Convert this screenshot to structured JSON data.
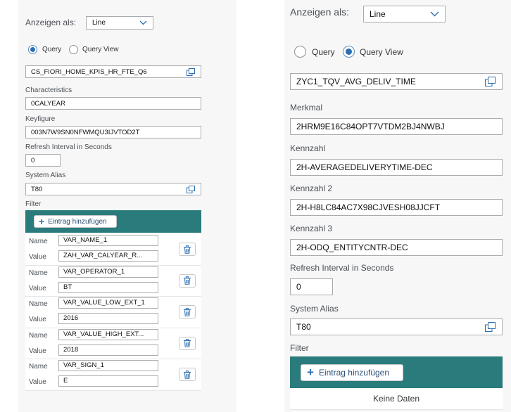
{
  "left": {
    "display_as_label": "Anzeigen als:",
    "display_as_value": "Line",
    "radio_query": "Query",
    "radio_query_view": "Query View",
    "selected": "Query",
    "query_value": "CS_FIORI_HOME_KPIS_HR_FTE_Q6",
    "characteristics_label": "Characteristics",
    "characteristics_value": "0CALYEAR",
    "keyfigure_label": "Keyfigure",
    "keyfigure_value": "003N7W9SN0NFWMQU3IJVTOD2T",
    "refresh_label": "Refresh Interval in Seconds",
    "refresh_value": "0",
    "system_alias_label": "System Alias",
    "system_alias_value": "T80",
    "filter_label": "Filter",
    "add_entry_label": "Eintrag hinzufügen",
    "name_label": "Name",
    "value_label": "Value",
    "filters": [
      {
        "name": "VAR_NAME_1",
        "value": "ZAH_VAR_CALYEAR_R..."
      },
      {
        "name": "VAR_OPERATOR_1",
        "value": "BT"
      },
      {
        "name": "VAR_VALUE_LOW_EXT_1",
        "value": "2016"
      },
      {
        "name": "VAR_VALUE_HIGH_EXT...",
        "value": "2018"
      },
      {
        "name": "VAR_SIGN_1",
        "value": "E"
      }
    ]
  },
  "right": {
    "display_as_label": "Anzeigen als:",
    "display_as_value": "Line",
    "radio_query": "Query",
    "radio_query_view": "Query View",
    "selected": "Query View",
    "query_view_value": "ZYC1_TQV_AVG_DELIV_TIME",
    "merkmal_label": "Merkmal",
    "merkmal_value": "2HRM9E16C84OPT7VTDM2BJ4NWBJ",
    "kennzahl_label": "Kennzahl",
    "kennzahl_value": "2H-AVERAGEDELIVERYTIME-DEC",
    "kennzahl2_label": "Kennzahl 2",
    "kennzahl2_value": "2H-H8LC84AC7X98CJVESH08JJCFT",
    "kennzahl3_label": "Kennzahl 3",
    "kennzahl3_value": "2H-ODQ_ENTITYCNTR-DEC",
    "refresh_label": "Refresh Interval in Seconds",
    "refresh_value": "0",
    "system_alias_label": "System Alias",
    "system_alias_value": "T80",
    "filter_label": "Filter",
    "add_entry_label": "Eintrag hinzufügen",
    "no_data_label": "Keine Daten"
  },
  "colors": {
    "accent": "#2a7b7b",
    "selected_radio": "#2c6fb0",
    "panel_bg": "#f7f7f7"
  }
}
